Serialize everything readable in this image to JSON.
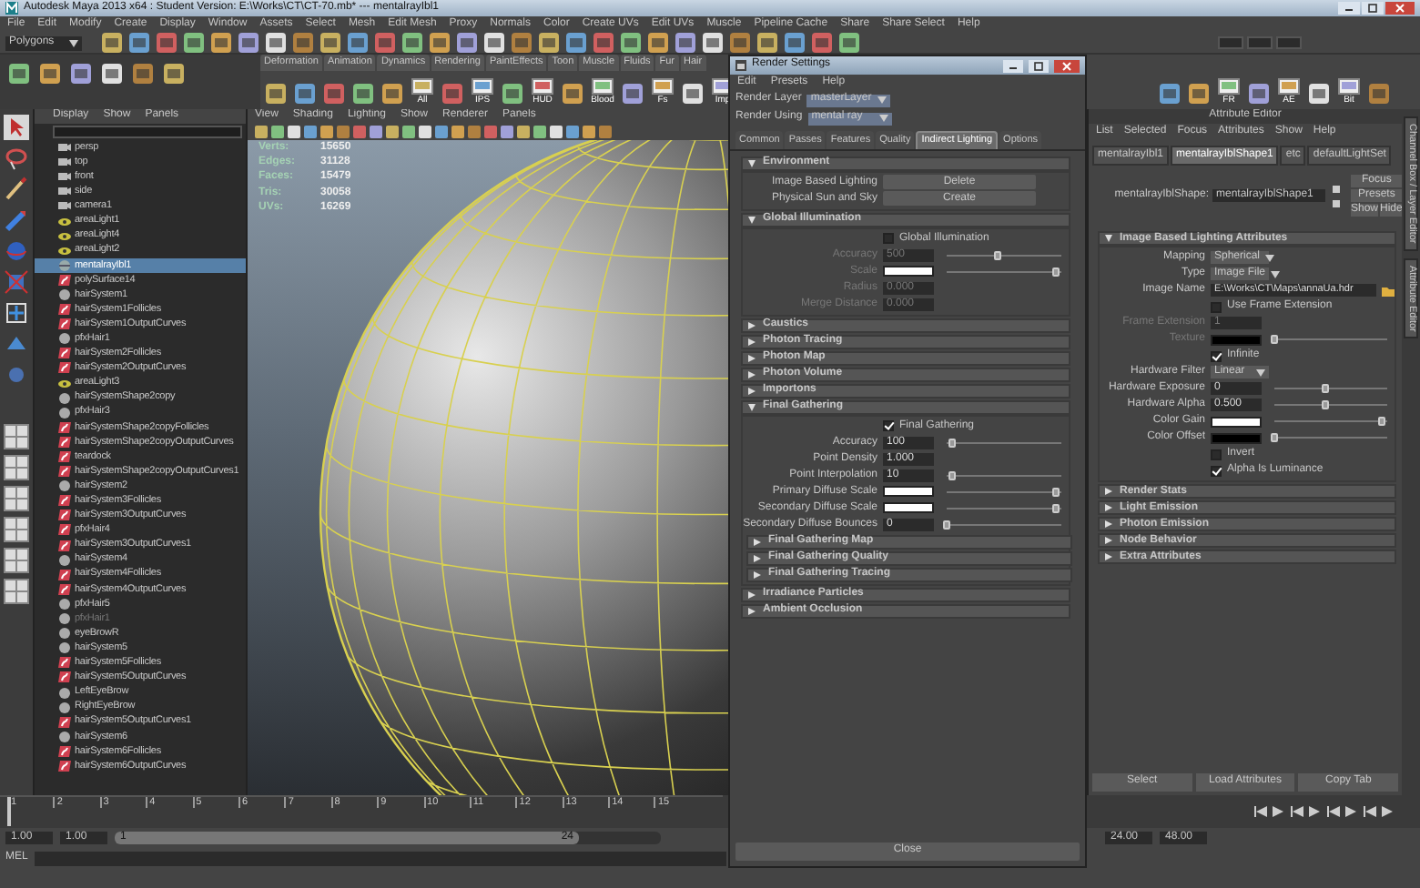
{
  "title": "Autodesk Maya 2013 x64 : Student Version: E:\\Works\\CT\\CT-70.mb*  ---  mentalrayIbl1",
  "menu_bar": [
    "File",
    "Edit",
    "Modify",
    "Create",
    "Display",
    "Window",
    "Assets",
    "Select",
    "Mesh",
    "Edit Mesh",
    "Proxy",
    "Normals",
    "Color",
    "Create UVs",
    "Edit UVs",
    "Muscle",
    "Pipeline Cache",
    "Share",
    "Share Select",
    "Help"
  ],
  "status_line": {
    "mode": "Polygons"
  },
  "shelf": {
    "tabs": [
      "Deformation",
      "Animation",
      "Dynamics",
      "Rendering",
      "PaintEffects",
      "Toon",
      "Muscle",
      "Fluids",
      "Fur",
      "Hair"
    ],
    "left_buttons": [
      "All",
      "IPS",
      "HUD",
      "Blood",
      "Fs",
      "Imp"
    ],
    "right_buttons": [
      "FR",
      "AE",
      "Bit"
    ]
  },
  "outliner": {
    "menu": [
      "Display",
      "Show",
      "Panels"
    ],
    "items": [
      {
        "label": "persp",
        "kind": "camera",
        "selected": false,
        "dimmed": false
      },
      {
        "label": "top",
        "kind": "camera",
        "selected": false,
        "dimmed": false
      },
      {
        "label": "front",
        "kind": "camera",
        "selected": false,
        "dimmed": false
      },
      {
        "label": "side",
        "kind": "camera",
        "selected": false,
        "dimmed": false
      },
      {
        "label": "camera1",
        "kind": "camera",
        "selected": false,
        "dimmed": false
      },
      {
        "label": "areaLight1",
        "kind": "light",
        "selected": false,
        "dimmed": false
      },
      {
        "label": "areaLight4",
        "kind": "light",
        "selected": false,
        "dimmed": false
      },
      {
        "label": "areaLight2",
        "kind": "light",
        "selected": false,
        "dimmed": false
      },
      {
        "label": "mentalrayIbl1",
        "kind": "ibl",
        "selected": true,
        "dimmed": false
      },
      {
        "label": "polySurface14",
        "kind": "curves",
        "selected": false,
        "dimmed": false
      },
      {
        "label": "hairSystem1",
        "kind": "node",
        "selected": false,
        "dimmed": false
      },
      {
        "label": "hairSystem1Follicles",
        "kind": "curves",
        "selected": false,
        "dimmed": false
      },
      {
        "label": "hairSystem1OutputCurves",
        "kind": "curves",
        "selected": false,
        "dimmed": false
      },
      {
        "label": "pfxHair1",
        "kind": "node",
        "selected": false,
        "dimmed": false
      },
      {
        "label": "hairSystem2Follicles",
        "kind": "curves",
        "selected": false,
        "dimmed": false
      },
      {
        "label": "hairSystem2OutputCurves",
        "kind": "curves",
        "selected": false,
        "dimmed": false
      },
      {
        "label": "areaLight3",
        "kind": "light",
        "selected": false,
        "dimmed": false
      },
      {
        "label": "hairSystemShape2copy",
        "kind": "node",
        "selected": false,
        "dimmed": false
      },
      {
        "label": "pfxHair3",
        "kind": "node",
        "selected": false,
        "dimmed": false
      },
      {
        "label": "hairSystemShape2copyFollicles",
        "kind": "curves",
        "selected": false,
        "dimmed": false
      },
      {
        "label": "hairSystemShape2copyOutputCurves",
        "kind": "curves",
        "selected": false,
        "dimmed": false
      },
      {
        "label": "teardock",
        "kind": "curves",
        "selected": false,
        "dimmed": false
      },
      {
        "label": "hairSystemShape2copyOutputCurves1",
        "kind": "curves",
        "selected": false,
        "dimmed": false
      },
      {
        "label": "hairSystem2",
        "kind": "node",
        "selected": false,
        "dimmed": false
      },
      {
        "label": "hairSystem3Follicles",
        "kind": "curves",
        "selected": false,
        "dimmed": false
      },
      {
        "label": "hairSystem3OutputCurves",
        "kind": "curves",
        "selected": false,
        "dimmed": false
      },
      {
        "label": "pfxHair4",
        "kind": "curves",
        "selected": false,
        "dimmed": false
      },
      {
        "label": "hairSystem3OutputCurves1",
        "kind": "curves",
        "selected": false,
        "dimmed": false
      },
      {
        "label": "hairSystem4",
        "kind": "node",
        "selected": false,
        "dimmed": false
      },
      {
        "label": "hairSystem4Follicles",
        "kind": "curves",
        "selected": false,
        "dimmed": false
      },
      {
        "label": "hairSystem4OutputCurves",
        "kind": "curves",
        "selected": false,
        "dimmed": false
      },
      {
        "label": "pfxHair5",
        "kind": "node",
        "selected": false,
        "dimmed": false
      },
      {
        "label": "pfxHair1",
        "kind": "node",
        "selected": false,
        "dimmed": true
      },
      {
        "label": "eyeBrowR",
        "kind": "node",
        "selected": false,
        "dimmed": false
      },
      {
        "label": "hairSystem5",
        "kind": "node",
        "selected": false,
        "dimmed": false
      },
      {
        "label": "hairSystem5Follicles",
        "kind": "curves",
        "selected": false,
        "dimmed": false
      },
      {
        "label": "hairSystem5OutputCurves",
        "kind": "curves",
        "selected": false,
        "dimmed": false
      },
      {
        "label": "LeftEyeBrow",
        "kind": "node",
        "selected": false,
        "dimmed": false
      },
      {
        "label": "RightEyeBrow",
        "kind": "node",
        "selected": false,
        "dimmed": false
      },
      {
        "label": "hairSystem5OutputCurves1",
        "kind": "curves",
        "selected": false,
        "dimmed": false
      },
      {
        "label": "hairSystem6",
        "kind": "node",
        "selected": false,
        "dimmed": false
      },
      {
        "label": "hairSystem6Follicles",
        "kind": "curves",
        "selected": false,
        "dimmed": false
      },
      {
        "label": "hairSystem6OutputCurves",
        "kind": "curves",
        "selected": false,
        "dimmed": false
      }
    ]
  },
  "viewport": {
    "menu": [
      "View",
      "Shading",
      "Lighting",
      "Show",
      "Renderer",
      "Panels"
    ],
    "hud": [
      {
        "label": "Verts:",
        "value": "15650"
      },
      {
        "label": "Edges:",
        "value": "31128"
      },
      {
        "label": "Faces:",
        "value": "15479"
      },
      {
        "label": "Tris:",
        "value": "30058"
      },
      {
        "label": "UVs:",
        "value": "16269"
      }
    ]
  },
  "render_settings": {
    "title": "Render Settings",
    "menu": [
      "Edit",
      "Presets",
      "Help"
    ],
    "render_layer": {
      "label": "Render Layer",
      "value": "masterLayer"
    },
    "render_using": {
      "label": "Render Using",
      "value": "mental ray"
    },
    "tabs": [
      {
        "label": "Common",
        "selected": false
      },
      {
        "label": "Passes",
        "selected": false
      },
      {
        "label": "Features",
        "selected": false
      },
      {
        "label": "Quality",
        "selected": false
      },
      {
        "label": "Indirect Lighting",
        "selected": true
      },
      {
        "label": "Options",
        "selected": false
      }
    ],
    "sections": [
      {
        "title": "Environment",
        "expanded": true,
        "rows": [
          {
            "kind": "button",
            "label": "Image Based Lighting",
            "button": "Delete"
          },
          {
            "kind": "button",
            "label": "Physical Sun and Sky",
            "button": "Create"
          }
        ]
      },
      {
        "title": "Global Illumination",
        "expanded": true,
        "rows": [
          {
            "kind": "checkbox",
            "label": "Global Illumination",
            "checked": false
          },
          {
            "kind": "number",
            "label": "Accuracy",
            "value": "500",
            "level": 0.45,
            "disabled": true
          },
          {
            "kind": "color",
            "label": "Scale",
            "color": "#ffffff",
            "level": 0.95,
            "disabled": true
          },
          {
            "kind": "number",
            "label": "Radius",
            "value": "0.000",
            "disabled": true
          },
          {
            "kind": "number",
            "label": "Merge Distance",
            "value": "0.000",
            "disabled": true
          }
        ]
      },
      {
        "title": "Caustics",
        "expanded": false
      },
      {
        "title": "Photon Tracing",
        "expanded": false
      },
      {
        "title": "Photon Map",
        "expanded": false
      },
      {
        "title": "Photon Volume",
        "expanded": false
      },
      {
        "title": "Importons",
        "expanded": false
      },
      {
        "title": "Final Gathering",
        "expanded": true,
        "rows": [
          {
            "kind": "checkbox",
            "label": "Final Gathering",
            "checked": true
          },
          {
            "kind": "number",
            "label": "Accuracy",
            "value": "100",
            "level": 0.05,
            "disabled": false
          },
          {
            "kind": "number",
            "label": "Point Density",
            "value": "1.000",
            "disabled": false
          },
          {
            "kind": "number",
            "label": "Point Interpolation",
            "value": "10",
            "level": 0.05,
            "disabled": false
          },
          {
            "kind": "color",
            "label": "Primary Diffuse Scale",
            "color": "#ffffff",
            "level": 0.95,
            "disabled": false
          },
          {
            "kind": "color",
            "label": "Secondary Diffuse Scale",
            "color": "#ffffff",
            "level": 0.95,
            "disabled": false
          },
          {
            "kind": "number",
            "label": "Secondary Diffuse Bounces",
            "value": "0",
            "level": 0.0,
            "disabled": false
          }
        ],
        "children": [
          {
            "title": "Final Gathering Map",
            "expanded": false
          },
          {
            "title": "Final Gathering Quality",
            "expanded": false
          },
          {
            "title": "Final Gathering Tracing",
            "expanded": false
          }
        ]
      },
      {
        "title": "Irradiance Particles",
        "expanded": false
      },
      {
        "title": "Ambient Occlusion",
        "expanded": false
      }
    ],
    "close_button": "Close"
  },
  "attribute_editor": {
    "title": "Attribute Editor",
    "menu": [
      "List",
      "Selected",
      "Focus",
      "Attributes",
      "Show",
      "Help"
    ],
    "tabs": [
      {
        "label": "mentalrayIbl1",
        "selected": false
      },
      {
        "label": "mentalrayIblShape1",
        "selected": true
      },
      {
        "label": "etc",
        "selected": false
      },
      {
        "label": "defaultLightSet",
        "selected": false
      }
    ],
    "node_label": "mentalrayIblShape:",
    "node_name": "mentalrayIblShape1",
    "buttons": [
      "Focus",
      "Presets",
      "Show",
      "Hide"
    ],
    "sections": [
      {
        "title": "Image Based Lighting Attributes",
        "expanded": true,
        "rows": [
          {
            "kind": "dropdown",
            "label": "Mapping",
            "value": "Spherical"
          },
          {
            "kind": "dropdown",
            "label": "Type",
            "value": "Image File"
          },
          {
            "kind": "path",
            "label": "Image Name",
            "value": "E:\\Works\\CT\\Maps\\annaUa.hdr"
          },
          {
            "kind": "checkbox",
            "label": "Use Frame Extension",
            "checked": false
          },
          {
            "kind": "number",
            "label": "Frame Extension",
            "value": "1",
            "disabled": true
          },
          {
            "kind": "color",
            "label": "Texture",
            "color": "#000000",
            "level": 0.0,
            "disabled": true
          },
          {
            "kind": "checkbox",
            "label": "Infinite",
            "checked": true
          },
          {
            "kind": "dropdown",
            "label": "Hardware Filter",
            "value": "Linear"
          },
          {
            "kind": "number",
            "label": "Hardware Exposure",
            "value": "0",
            "level": 0.45,
            "disabled": false
          },
          {
            "kind": "number",
            "label": "Hardware Alpha",
            "value": "0.500",
            "level": 0.45,
            "disabled": false
          },
          {
            "kind": "color",
            "label": "Color Gain",
            "color": "#ffffff",
            "level": 0.95,
            "disabled": false
          },
          {
            "kind": "color",
            "label": "Color Offset",
            "color": "#000000",
            "level": 0.0,
            "disabled": false
          },
          {
            "kind": "checkbox",
            "label": "Invert",
            "checked": false
          },
          {
            "kind": "checkbox",
            "label": "Alpha Is Luminance",
            "checked": true
          }
        ]
      },
      {
        "title": "Render Stats",
        "expanded": false
      },
      {
        "title": "Light Emission",
        "expanded": false
      },
      {
        "title": "Photon Emission",
        "expanded": false
      },
      {
        "title": "Node Behavior",
        "expanded": false
      },
      {
        "title": "Extra Attributes",
        "expanded": false
      }
    ],
    "bottom_buttons": [
      "Select",
      "Load Attributes",
      "Copy Tab"
    ]
  },
  "side_tabs": [
    "Channel Box / Layer Editor",
    "Attribute Editor"
  ],
  "time_slider": {
    "level": 0.0,
    "ticks": [
      "1",
      "2",
      "3",
      "4",
      "5",
      "6",
      "7",
      "8",
      "9",
      "10",
      "11",
      "12",
      "13",
      "14",
      "15"
    ]
  },
  "range_slider": {
    "start": "1.00",
    "playback_start": "1.00",
    "range_start": "1",
    "range_end": "24",
    "playback_end": "24.00",
    "end": "48.00",
    "level": 0.85
  },
  "command_line": {
    "label": "MEL"
  }
}
